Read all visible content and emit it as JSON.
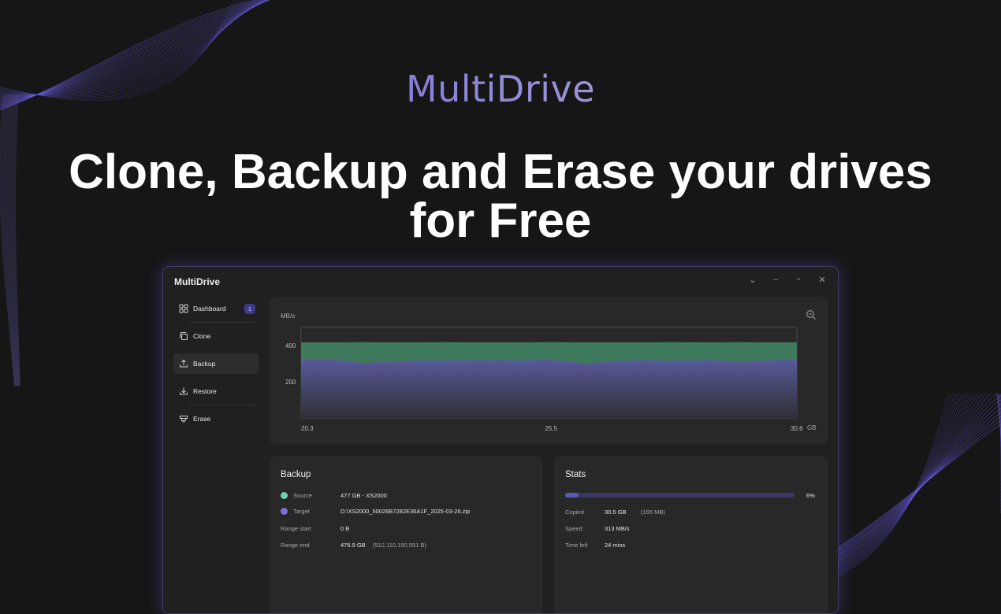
{
  "marketing": {
    "brand": "MultiDrive",
    "headline_line1": "Clone, Backup and Erase your drives",
    "headline_line2": "for Free"
  },
  "window": {
    "title": "MultiDrive",
    "controls": {
      "collapse": "⌄",
      "minimize": "–",
      "maximize": "▫",
      "close": "✕"
    }
  },
  "sidebar": {
    "items": [
      {
        "label": "Dashboard",
        "icon": "dashboard-icon",
        "badge": "1"
      },
      {
        "label": "Clone",
        "icon": "copy-icon"
      },
      {
        "label": "Backup",
        "icon": "upload-icon",
        "active": true
      },
      {
        "label": "Restore",
        "icon": "download-icon"
      },
      {
        "label": "Erase",
        "icon": "eraser-icon"
      }
    ]
  },
  "chart": {
    "unit_y": "MB/s",
    "unit_x": "GB",
    "y_ticks": [
      "400",
      "200"
    ],
    "x_ticks": [
      "20.3",
      "25.5",
      "30.6"
    ],
    "zoom_icon": "zoom-out-icon"
  },
  "chart_data": {
    "type": "area",
    "xlim": [
      20.3,
      30.6
    ],
    "ylim": [
      0,
      500
    ],
    "colors": {
      "read": "#3f7a5d",
      "write": "#595a9a"
    },
    "x": [
      20.3,
      21.0,
      21.6,
      22.0,
      22.6,
      23.2,
      24.0,
      24.8,
      25.5,
      26.2,
      26.8,
      27.4,
      28.0,
      28.8,
      29.4,
      30.0,
      30.6
    ],
    "series": [
      {
        "values": [
          418,
          418,
          419,
          418,
          418,
          419,
          418,
          418,
          419,
          418,
          418,
          418,
          419,
          418,
          419,
          418,
          418
        ]
      },
      {
        "values": [
          322,
          322,
          304,
          310,
          316,
          318,
          320,
          318,
          322,
          302,
          314,
          320,
          316,
          320,
          312,
          318,
          322
        ]
      }
    ]
  },
  "backup": {
    "title": "Backup",
    "source_label": "Source",
    "source_value": "477 GB - XS2000",
    "target_label": "Target",
    "target_value": "D:\\XS2000_50026B7282E36A1F_2025-03-26.zip",
    "range_start_label": "Range start",
    "range_start_value": "0 B",
    "range_end_label": "Range end",
    "range_end_value": "476.9 GB",
    "range_end_bytes": "(512,110,190,591 B)",
    "source_color": "#6fd1b0",
    "target_color": "#7e6fd8"
  },
  "stats": {
    "title": "Stats",
    "progress": 0.06,
    "progress_label": "6%",
    "copied_label": "Copied",
    "copied_value": "30.5 GB",
    "copied_mb": "(165 MB)",
    "speed_label": "Speed",
    "speed_value": "313 MB/s",
    "time_left_label": "Time left",
    "time_left_value": "24 mins"
  }
}
